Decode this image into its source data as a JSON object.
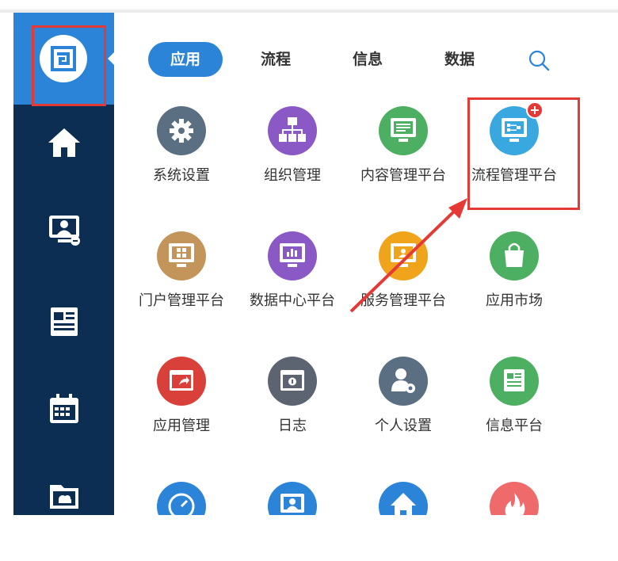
{
  "tabs": [
    {
      "label": "应用",
      "active": true
    },
    {
      "label": "流程",
      "active": false
    },
    {
      "label": "信息",
      "active": false
    },
    {
      "label": "数据",
      "active": false
    }
  ],
  "search": {
    "icon": "search-icon"
  },
  "sidebar": {
    "logo_icon": "app-logo-icon",
    "items": [
      {
        "icon": "home-icon"
      },
      {
        "icon": "monitor-user-icon"
      },
      {
        "icon": "news-icon"
      },
      {
        "icon": "calendar-icon"
      },
      {
        "icon": "cloud-folder-icon"
      }
    ]
  },
  "apps": [
    {
      "label": "系统设置",
      "color": "#5b6f82",
      "icon": "gear-icon"
    },
    {
      "label": "组织管理",
      "color": "#8b59c6",
      "icon": "org-chart-icon"
    },
    {
      "label": "内容管理平台",
      "color": "#4caf61",
      "icon": "monitor-doc-icon"
    },
    {
      "label": "流程管理平台",
      "color": "#39a8e0",
      "icon": "monitor-flow-icon",
      "badge": true
    },
    {
      "label": "门户管理平台",
      "color": "#c4955a",
      "icon": "monitor-grid-icon"
    },
    {
      "label": "数据中心平台",
      "color": "#8b59c6",
      "icon": "monitor-chart-icon"
    },
    {
      "label": "服务管理平台",
      "color": "#f0a41c",
      "icon": "monitor-service-icon"
    },
    {
      "label": "应用市场",
      "color": "#4caf61",
      "icon": "shopping-bag-icon"
    },
    {
      "label": "应用管理",
      "color": "#d9403a",
      "icon": "window-share-icon"
    },
    {
      "label": "日志",
      "color": "#5b6470",
      "icon": "window-log-icon"
    },
    {
      "label": "个人设置",
      "color": "#5b6f82",
      "icon": "user-gear-icon"
    },
    {
      "label": "信息平台",
      "color": "#4caf61",
      "icon": "newspaper-icon"
    },
    {
      "label": "",
      "color": "#2b84d8",
      "icon": "clock-icon"
    },
    {
      "label": "",
      "color": "#2b84d8",
      "icon": "monitor-user-icon"
    },
    {
      "label": "",
      "color": "#2b84d8",
      "icon": "home-icon"
    },
    {
      "label": "",
      "color": "#ef6b6b",
      "icon": "fire-icon"
    }
  ]
}
